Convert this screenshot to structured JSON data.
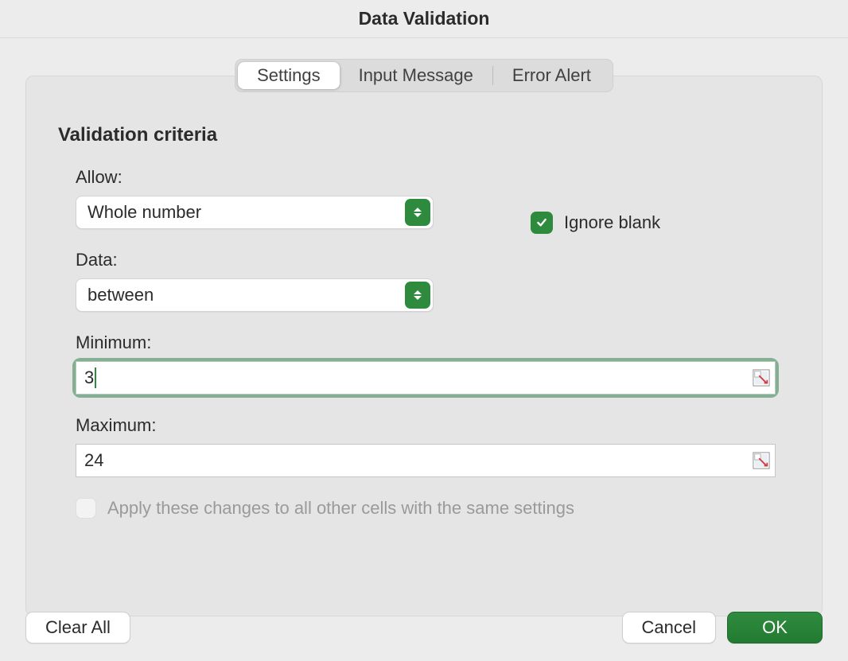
{
  "dialog": {
    "title": "Data Validation"
  },
  "tabs": {
    "settings": "Settings",
    "input_message": "Input Message",
    "error_alert": "Error Alert",
    "active": "settings"
  },
  "panel": {
    "section_title": "Validation criteria",
    "allow": {
      "label": "Allow:",
      "value": "Whole number"
    },
    "ignore_blank": {
      "label": "Ignore blank",
      "checked": true
    },
    "data": {
      "label": "Data:",
      "value": "between"
    },
    "minimum": {
      "label": "Minimum:",
      "value": "3",
      "focused": true
    },
    "maximum": {
      "label": "Maximum:",
      "value": "24",
      "focused": false
    },
    "apply_all": {
      "label": "Apply these changes to all other cells with the same settings",
      "checked": false,
      "enabled": false
    }
  },
  "buttons": {
    "clear_all": "Clear All",
    "cancel": "Cancel",
    "ok": "OK"
  }
}
